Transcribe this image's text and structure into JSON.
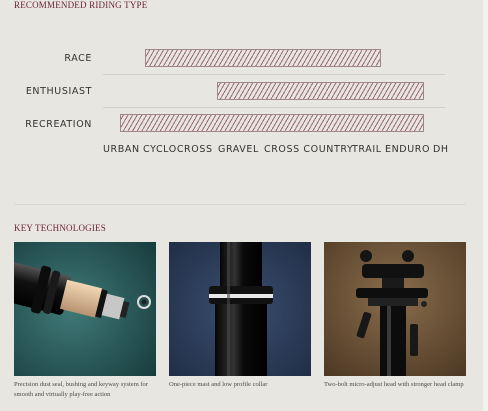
{
  "riding_section": {
    "title": "RECOMMENDED RIDING TYPE",
    "rows": [
      {
        "label": "RACE",
        "range": [
          "CYCLOCROSS",
          "TRAIL"
        ]
      },
      {
        "label": "ENTHUSIAST",
        "range": [
          "GRAVEL",
          "DH"
        ]
      },
      {
        "label": "RECREATION",
        "range": [
          "URBAN",
          "DH"
        ]
      }
    ],
    "axis": [
      "URBAN",
      "CYCLOCROSS",
      "GRAVEL",
      "CROSS COUNTRY",
      "TRAIL",
      "ENDURO",
      "DH"
    ]
  },
  "tech_section": {
    "title": "KEY TECHNOLOGIES",
    "cards": [
      {
        "caption": "Precision dust seal, bushing and keyway system for smooth and virtually play-free action",
        "image": "dropper-post-seal-photo"
      },
      {
        "caption": "One-piece mast and low profile collar",
        "image": "seatpost-collar-photo"
      },
      {
        "caption": "Two-bolt micro-adjust head with stronger head clamp",
        "image": "seatpost-head-clamp-photo"
      }
    ]
  },
  "colors": {
    "accent": "#6b1f2e",
    "hatch": "#9a6a73",
    "background": "#e7e6e1"
  }
}
